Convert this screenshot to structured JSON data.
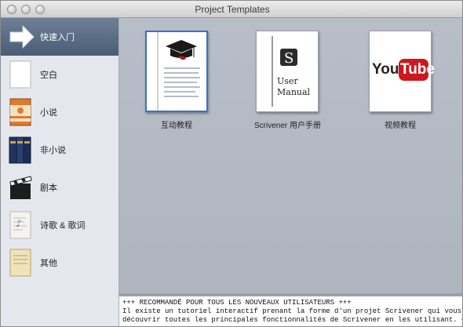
{
  "window": {
    "title": "Project Templates"
  },
  "sidebar": {
    "items": [
      {
        "label": "快速入门",
        "icon": "arrow-right-icon",
        "selected": true
      },
      {
        "label": "空白",
        "icon": "blank-page-icon",
        "selected": false
      },
      {
        "label": "小说",
        "icon": "book-icon",
        "selected": false
      },
      {
        "label": "非小说",
        "icon": "book-stack-icon",
        "selected": false
      },
      {
        "label": "剧本",
        "icon": "clapperboard-icon",
        "selected": false
      },
      {
        "label": "诗歌 & 歌词",
        "icon": "poetry-page-icon",
        "selected": false
      },
      {
        "label": "其他",
        "icon": "document-icon",
        "selected": false
      }
    ]
  },
  "templates": [
    {
      "label": "互动教程",
      "icon": "graduation-cap-icon",
      "selected": true
    },
    {
      "label": "Scrivener 用户手册",
      "icon": "user-manual-icon",
      "thumb_text": [
        "User",
        "Manual"
      ],
      "selected": false
    },
    {
      "label": "视频教程",
      "icon": "youtube-icon",
      "thumb_text": [
        "You",
        "Tube"
      ],
      "selected": false
    }
  ],
  "description": {
    "lines": [
      "+++ RECOMMANDÉ POUR TOUS LES NOUVEAUX UTILISATEURS +++",
      "Il existe un tutoriel interactif prenant la forme d'un projet Scrivener qui vous permet de",
      "découvrir toutes les principales fonctionnalités de Scrivener en les utilisant. Ce tutoriel permet"
    ]
  },
  "colors": {
    "selection": "#4a5d76",
    "youtube_red": "#cc181e",
    "selected_border": "#3c6fd0"
  }
}
